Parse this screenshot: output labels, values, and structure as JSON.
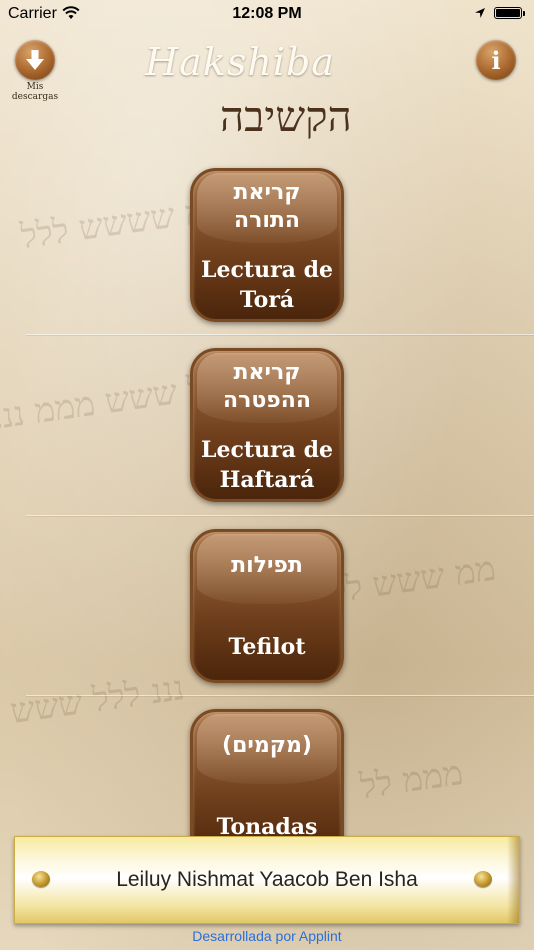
{
  "status_bar": {
    "carrier": "Carrier",
    "time": "12:08 PM",
    "wifi_icon": "wifi-icon",
    "location_icon": "location-arrow-icon",
    "battery_icon": "battery-icon"
  },
  "header": {
    "downloads_icon": "download-arrow-icon",
    "downloads_label_line1": "Mis",
    "downloads_label_line2": "descargas",
    "info_glyph": "i",
    "logo_latin": "Hakshiba",
    "logo_hebrew": "הקשיבה"
  },
  "menu": [
    {
      "hebrew_line1": "קריאת",
      "hebrew_line2": "התורה",
      "label_line1": "Lectura de",
      "label_line2": "Torá"
    },
    {
      "hebrew_line1": "קריאת",
      "hebrew_line2": "ההפטרה",
      "label_line1": "Lectura de",
      "label_line2": "Haftará"
    },
    {
      "hebrew_line1": "תפילות",
      "label_line1": "Tefilot"
    },
    {
      "hebrew_line1": "(מקמים)",
      "label_line1": "Tonadas"
    }
  ],
  "banner": {
    "text": "Leiluy Nishmat Yaacob Ben Isha"
  },
  "credit": "Desarrollada por Applint",
  "colors": {
    "button_brown": "#74431f",
    "banner_gold": "#f3e5a3",
    "link_blue": "#2a6fdc"
  }
}
